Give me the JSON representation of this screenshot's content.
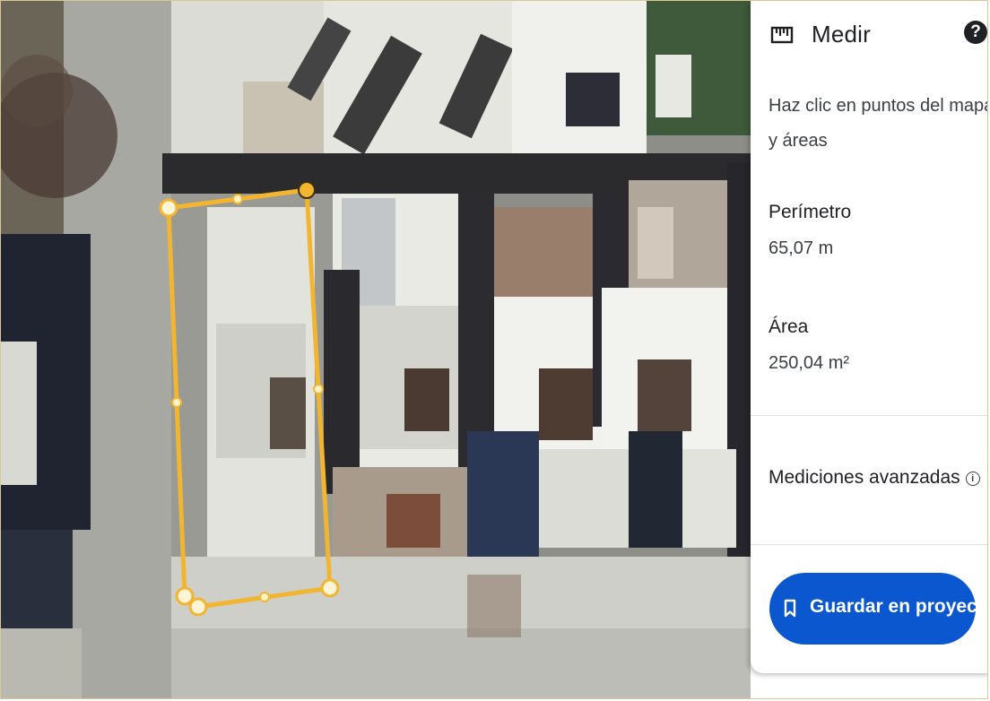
{
  "panel": {
    "title": "Medir",
    "ruler_icon": "ruler-icon",
    "help_icon": "help-icon",
    "help_symbol": "?",
    "instructions_line1": "Haz clic en puntos del mapa par",
    "instructions_line2": "y áreas",
    "perimeter_label": "Perímetro",
    "perimeter_value": "65,07 m",
    "area_label": "Área",
    "area_value": "250,04 m²",
    "advanced_label": "Mediciones avanzadas",
    "info_icon": "info-icon",
    "info_symbol": "i",
    "save_button_label": "Guardar en proyecto",
    "save_button_icon": "bookmark-icon"
  },
  "colors": {
    "measure_outline": "#f2b530",
    "button_blue": "#0b57d0"
  }
}
